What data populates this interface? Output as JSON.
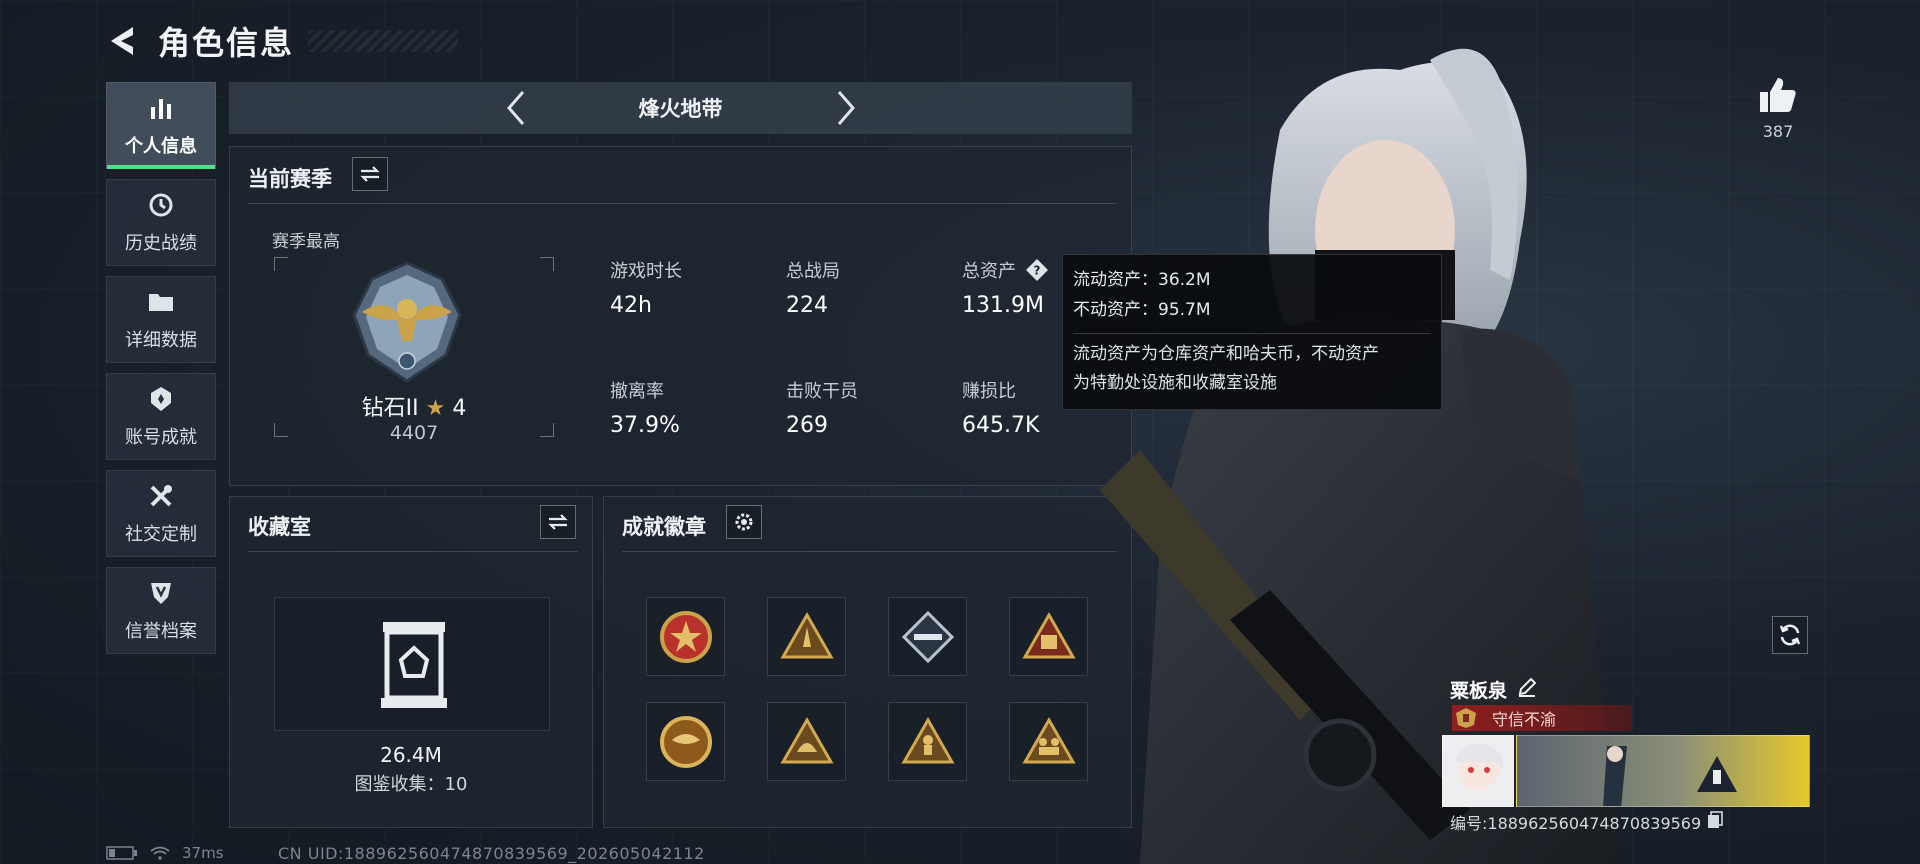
{
  "header": {
    "title": "角色信息"
  },
  "sidebar": {
    "items": [
      {
        "label": "个人信息",
        "icon": "bar-chart-icon",
        "active": true
      },
      {
        "label": "历史战绩",
        "icon": "history-clock-icon",
        "active": false
      },
      {
        "label": "详细数据",
        "icon": "folder-icon",
        "active": false
      },
      {
        "label": "账号成就",
        "icon": "medal-icon",
        "active": false
      },
      {
        "label": "社交定制",
        "icon": "tools-icon",
        "active": false
      },
      {
        "label": "信誉档案",
        "icon": "shield-icon",
        "active": false
      }
    ]
  },
  "mode": {
    "title": "烽火地带"
  },
  "season": {
    "title": "当前赛季",
    "best_label": "赛季最高",
    "rank_name": "钻石II",
    "rank_stars": "4",
    "rank_score": "4407",
    "stats": [
      {
        "label": "游戏时长",
        "value": "42h"
      },
      {
        "label": "总战局",
        "value": "224"
      },
      {
        "label": "总资产",
        "value": "131.9M"
      },
      {
        "label": "撤离率",
        "value": "37.9%"
      },
      {
        "label": "击败干员",
        "value": "269"
      },
      {
        "label": "赚损比",
        "value": "645.7K"
      }
    ]
  },
  "tooltip": {
    "liquid": "流动资产：36.2M",
    "fixed": "不动资产：95.7M",
    "desc_line1": "流动资产为仓库资产和哈夫币，不动资产",
    "desc_line2": "为特勤处设施和收藏室设施"
  },
  "collection": {
    "title": "收藏室",
    "value": "26.4M",
    "count": "图鉴收集：10"
  },
  "achievements": {
    "title": "成就徽章",
    "badges": [
      "badge-star-round",
      "badge-triangle-rocket",
      "badge-diamond-gun",
      "badge-triangle-crate",
      "badge-round-eagle",
      "badge-triangle-helmet",
      "badge-triangle-soldier",
      "badge-triangle-squad"
    ]
  },
  "likes": {
    "count": "387"
  },
  "player": {
    "name": "粟板泉",
    "title": "守信不渝",
    "id": "编号:1889625604748​70839569"
  },
  "status": {
    "ping": "37ms",
    "uid": "CN UID:188962560474870839569_202605042112"
  },
  "colors": {
    "accent_green": "#4fe08a",
    "gold": "#c9a24a",
    "title_red": "#9a1e1e"
  }
}
